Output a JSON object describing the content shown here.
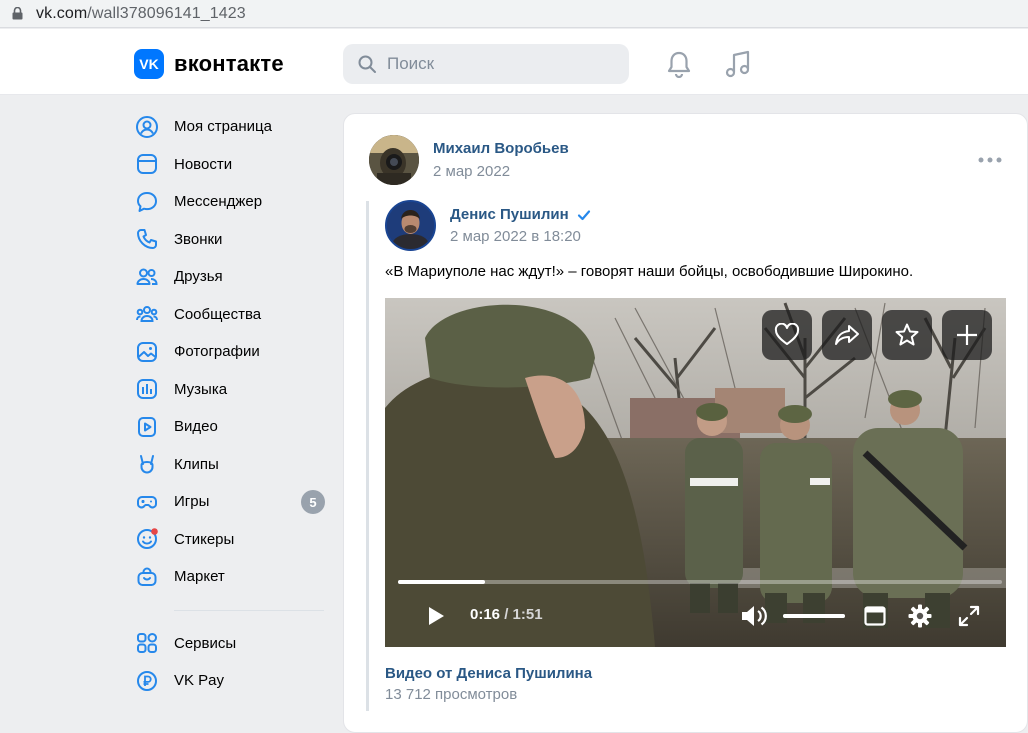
{
  "browser": {
    "url_domain": "vk.com",
    "url_path": "/wall378096141_1423"
  },
  "header": {
    "logo_mark": "VK",
    "logo_text": "вконтакте",
    "search_placeholder": "Поиск"
  },
  "sidebar": {
    "items": [
      {
        "label": "Моя страница",
        "icon": "user-circle-icon"
      },
      {
        "label": "Новости",
        "icon": "news-icon"
      },
      {
        "label": "Мессенджер",
        "icon": "message-icon"
      },
      {
        "label": "Звонки",
        "icon": "phone-icon"
      },
      {
        "label": "Друзья",
        "icon": "friends-icon"
      },
      {
        "label": "Сообщества",
        "icon": "communities-icon"
      },
      {
        "label": "Фотографии",
        "icon": "photo-icon"
      },
      {
        "label": "Музыка",
        "icon": "music-icon"
      },
      {
        "label": "Видео",
        "icon": "video-icon"
      },
      {
        "label": "Клипы",
        "icon": "clips-icon"
      },
      {
        "label": "Игры",
        "icon": "games-icon",
        "badge": "5"
      },
      {
        "label": "Стикеры",
        "icon": "stickers-icon"
      },
      {
        "label": "Маркет",
        "icon": "market-icon"
      }
    ],
    "extra_items": [
      {
        "label": "Сервисы",
        "icon": "services-icon"
      },
      {
        "label": "VK Pay",
        "icon": "vkpay-icon"
      }
    ]
  },
  "post": {
    "author_name": "Михаил Воробьев",
    "author_date": "2 мар 2022",
    "source_name": "Денис Пушилин",
    "source_date": "2 мар 2022 в 18:20",
    "text": "«В Мариуполе нас ждут!» – говорят наши бойцы, освободившие Широкино.",
    "video": {
      "current_time": "0:16",
      "separator": " / ",
      "duration": "1:51",
      "progress": 0.144,
      "volume": 1.0,
      "title": "Видео от Дениса Пушилина",
      "views": "13 712 просмотров"
    }
  },
  "colors": {
    "accent": "#0077ff",
    "link": "#2a5885",
    "secondary_text": "#818c99",
    "page_bg": "#edeef0"
  }
}
